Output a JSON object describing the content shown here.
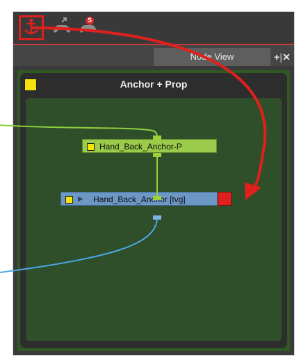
{
  "toolbar": {
    "tools": [
      {
        "icon": "anchor-icon",
        "highlighted": true
      },
      {
        "icon": "gamepad-arrow-icon",
        "highlighted": false
      },
      {
        "icon": "gamepad-badge-icon",
        "highlighted": false,
        "badge": "S"
      }
    ]
  },
  "tab": {
    "label": "Node View",
    "actions": [
      "+",
      "✕"
    ]
  },
  "group": {
    "title": "Anchor + Prop",
    "color": "#f5e10d"
  },
  "nodes": {
    "peg": {
      "label": "Hand_Back_Anchor-P",
      "color": "#9acb4a"
    },
    "drawing": {
      "label": "Hand_Back_Anchor  [tvg]",
      "color": "#6d97c4",
      "marker_color": "#e0201c"
    }
  },
  "annotation": {
    "highlight_color": "#e0201c",
    "arrow_color": "#e0201c"
  }
}
